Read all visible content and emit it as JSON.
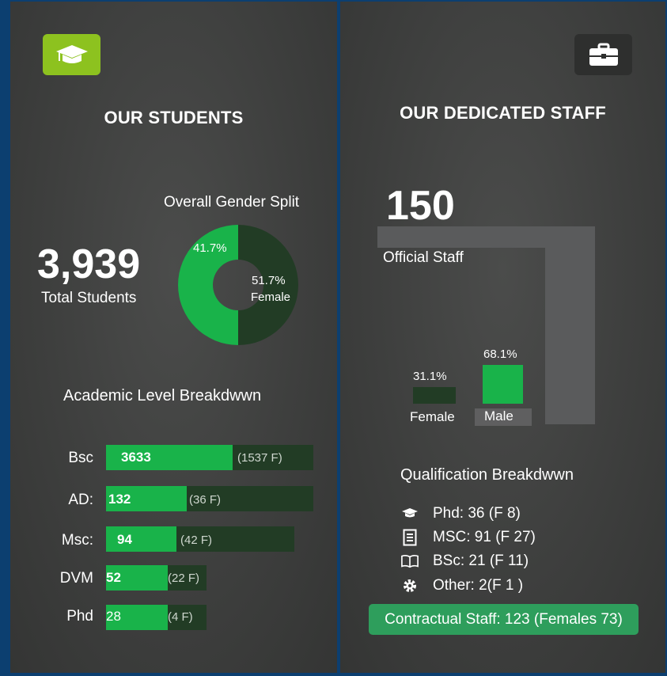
{
  "students": {
    "title": "OUR STUDENTS",
    "total": "3,939",
    "total_label": "Total Students",
    "gender_title": "Overall Gender Split",
    "male_pct": "41.7%",
    "female_pct": "51.7%",
    "female_label": "Female",
    "gender_split": {
      "green_share": 0.5,
      "dark_share": 0.5
    },
    "breakdown_title": "Academic Level Breakdwwn",
    "levels": [
      {
        "label": "Bsc",
        "value": "3633",
        "female": "(1537 F)"
      },
      {
        "label": "AD:",
        "value": "132",
        "female": "(36 F)"
      },
      {
        "label": "Msc:",
        "value": "94",
        "female": "(42 F)"
      },
      {
        "label": "DVM",
        "value": "52",
        "female": "(22 F)"
      },
      {
        "label": "Phd",
        "value": "28",
        "female": "(4 F)"
      }
    ]
  },
  "staff": {
    "title": "OUR DEDICATED STAFF",
    "total": "150",
    "total_label": "Official Staff",
    "female_pct": "31.1%",
    "male_pct": "68.1%",
    "female_label": "Female",
    "male_label": "Male",
    "qual_title": "Qualification Breakdwwn",
    "qualifications": [
      {
        "icon": "graduation-cap-icon",
        "text": "Phd: 36 (F 8)"
      },
      {
        "icon": "document-icon",
        "text": "MSC: 91 (F 27)"
      },
      {
        "icon": "open-book-icon",
        "text": "BSc: 21 (F 11)"
      },
      {
        "icon": "gear-icon",
        "text": "Other: 2(F 1 )"
      }
    ],
    "contractual": "Contractual Staff: 123 (Females 73)"
  },
  "colors": {
    "accent_green": "#19b34a",
    "dark_green": "#223c25",
    "tile_lime": "#8dc21f",
    "pill_green": "#2e9e5c"
  }
}
